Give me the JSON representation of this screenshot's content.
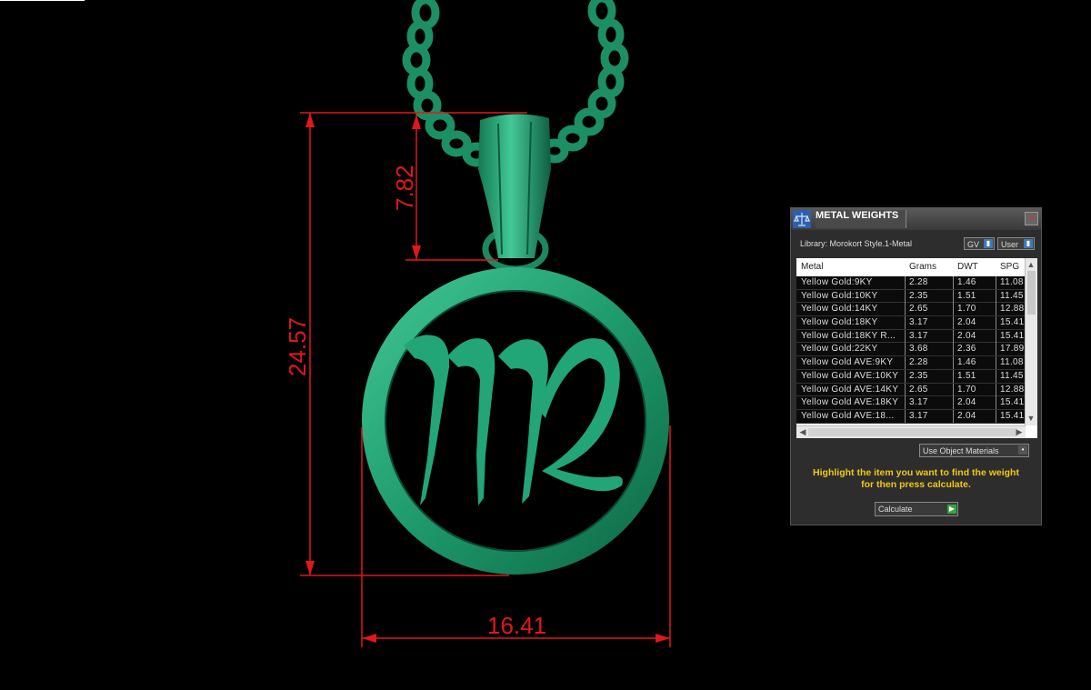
{
  "drawing": {
    "dimensions": [
      {
        "name": "total-height",
        "label": "24.57"
      },
      {
        "name": "bail-height",
        "label": "7.82"
      },
      {
        "name": "width",
        "label": "16.41"
      }
    ],
    "colors": {
      "metal": "#1f9e6f",
      "dimension_lines": "#e01818",
      "background": "#000000"
    }
  },
  "panel": {
    "title": "METAL WEIGHTS",
    "close": "×",
    "library": "Library: Morokort Style.1-Metal",
    "gv_label": "GV",
    "user_label": "User",
    "columns": [
      "Metal",
      "Grams",
      "DWT",
      "SPG"
    ],
    "rows": [
      [
        "Yellow Gold:9KY",
        "2.28",
        "1.46",
        "11.08"
      ],
      [
        "Yellow Gold:10KY",
        "2.35",
        "1.51",
        "11.45"
      ],
      [
        "Yellow Gold:14KY",
        "2.65",
        "1.70",
        "12.88"
      ],
      [
        "Yellow Gold:18KY",
        "3.17",
        "2.04",
        "15.41"
      ],
      [
        "Yellow Gold:18KY R...",
        "3.17",
        "2.04",
        "15.41"
      ],
      [
        "Yellow Gold:22KY",
        "3.68",
        "2.36",
        "17.89"
      ],
      [
        "Yellow Gold AVE:9KY",
        "2.28",
        "1.46",
        "11.08"
      ],
      [
        "Yellow Gold AVE:10KY",
        "2.35",
        "1.51",
        "11.45"
      ],
      [
        "Yellow Gold AVE:14KY",
        "2.65",
        "1.70",
        "12.88"
      ],
      [
        "Yellow Gold AVE:18KY",
        "3.17",
        "2.04",
        "15.41"
      ],
      [
        "Yellow Gold AVE:18...",
        "3.17",
        "2.04",
        "15.41"
      ]
    ],
    "use_object_materials": "Use Object Materials",
    "instruction_line1": "Highlight the item you want to find the weight",
    "instruction_line2": "for then press calculate.",
    "calculate": "Calculate"
  }
}
